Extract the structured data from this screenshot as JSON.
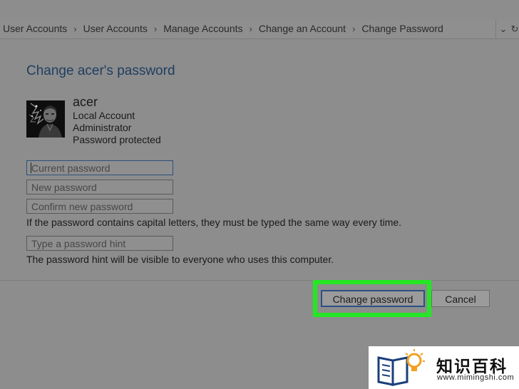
{
  "breadcrumb": {
    "items": [
      "User Accounts",
      "User Accounts",
      "Manage Accounts",
      "Change an Account",
      "Change Password"
    ],
    "separator": "›"
  },
  "page": {
    "title": "Change acer's password"
  },
  "user": {
    "name": "acer",
    "account_type": "Local Account",
    "role": "Administrator",
    "status": "Password protected"
  },
  "form": {
    "current_password_placeholder": "Current password",
    "new_password_placeholder": "New password",
    "confirm_password_placeholder": "Confirm new password",
    "caps_note": "If the password contains capital letters, they must be typed the same way every time.",
    "hint_placeholder": "Type a password hint",
    "hint_note": "The password hint will be visible to everyone who uses this computer."
  },
  "buttons": {
    "change_password": "Change password",
    "cancel": "Cancel"
  },
  "watermark": {
    "text": "知识百科",
    "url": "www.mimingshi.com"
  },
  "colors": {
    "highlight": "#25e625",
    "title": "#1f3e62",
    "focus_border": "#2d4f80"
  }
}
